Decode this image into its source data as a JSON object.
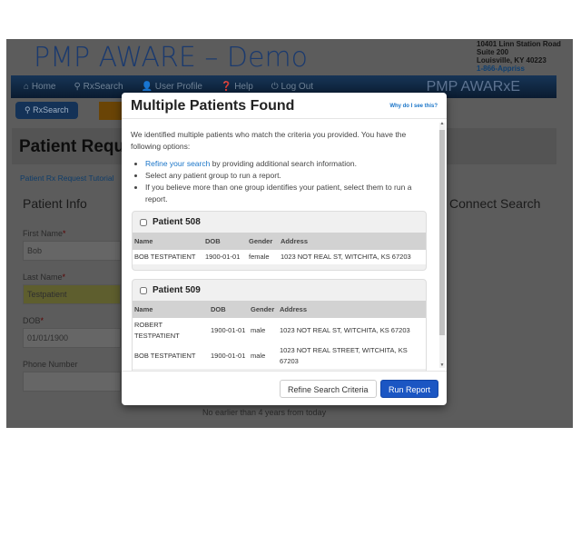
{
  "header": {
    "title": "PMP AWARE – Demo",
    "address": [
      "10401 Linn Station Road",
      "Suite 200",
      "Louisville, KY 40223"
    ],
    "phone": "1-866-Appriss"
  },
  "nav": {
    "items": [
      "⌂ Home",
      "⚲ RxSearch",
      "👤 User Profile",
      "❓ Help",
      "⏻ Log Out"
    ],
    "brand": "PMP AWARxE"
  },
  "breadcrumb": {
    "current": "⚲ RxSearch"
  },
  "page": {
    "title": "Patient Request",
    "tutorial_link": "Patient Rx Request Tutorial",
    "section": "Patient Info",
    "right_section": "Connect Search",
    "first_name_label": "First Name",
    "first_name": "Bob",
    "last_name_label": "Last Name",
    "last_name": "Testpatient",
    "dob_label": "DOB",
    "dob": "01/01/1900",
    "phone_label": "Phone Number",
    "phone": "",
    "hint": "No earlier than 4 years from today"
  },
  "modal": {
    "title": "Multiple Patients Found",
    "why_link": "Why do I see this?",
    "intro": "We identified multiple patients who match the criteria you provided. You have the following options:",
    "bullet1_link": "Refine your search",
    "bullet1_rest": " by providing additional search information.",
    "bullet2": "Select any patient group to run a report.",
    "bullet3": "If you believe more than one group identifies your patient, select them to run a report.",
    "columns": [
      "Name",
      "DOB",
      "Gender",
      "Address"
    ],
    "groups": [
      {
        "label": "Patient 508",
        "checked": false,
        "rows": [
          [
            "BOB TESTPATIENT",
            "1900-01-01",
            "female",
            "1023 NOT REAL ST, WITCHITA, KS 67203"
          ]
        ]
      },
      {
        "label": "Patient 509",
        "checked": false,
        "rows": [
          [
            "ROBERT TESTPATIENT",
            "1900-01-01",
            "male",
            "1023 NOT REAL ST, WITCHITA, KS 67203"
          ],
          [
            "BOB TESTPATIENT",
            "1900-01-01",
            "male",
            "1023 NOT REAL STREET, WITCHITA, KS 67203"
          ]
        ]
      }
    ],
    "refine_button": "Refine Search Criteria",
    "run_button": "Run Report"
  }
}
